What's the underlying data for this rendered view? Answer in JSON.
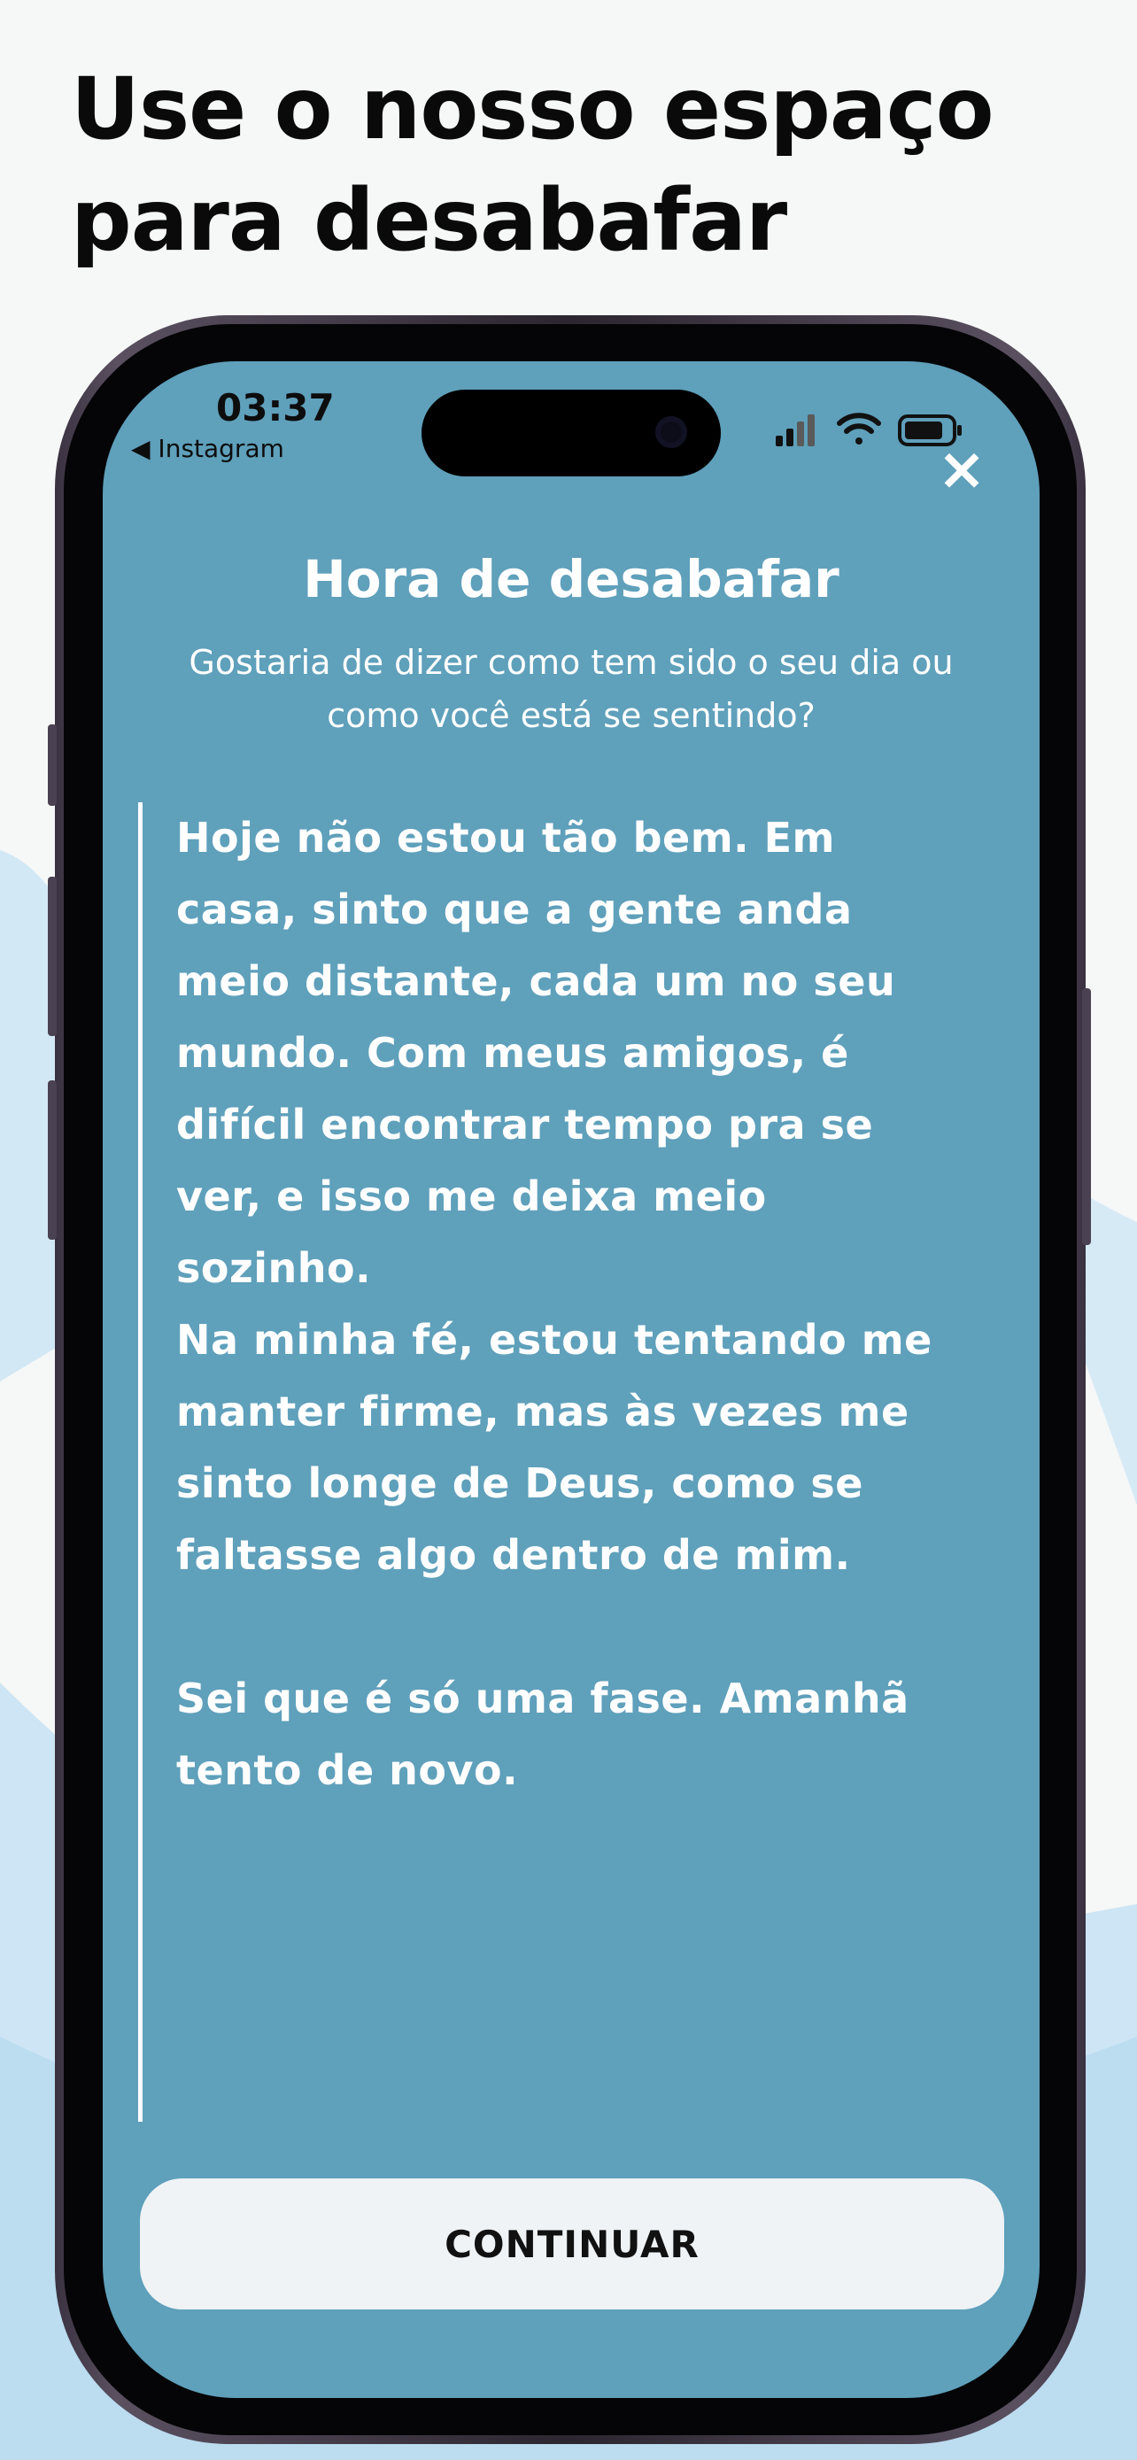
{
  "headline": {
    "line1": "Use o nosso espaço",
    "line2": "para desabafar"
  },
  "status_bar": {
    "time": "03:37",
    "back_label": "◀ Instagram",
    "icons": [
      "cellular-signal-icon",
      "wifi-icon",
      "battery-icon"
    ]
  },
  "modal": {
    "close_icon": "×",
    "title": "Hora de desabafar",
    "subtitle": "Gostaria de dizer como tem sido o seu dia ou como você está se sentindo?",
    "entry_text": "Hoje não estou tão bem. Em casa, sinto que a gente anda meio distante, cada um no seu mundo. Com meus amigos, é difícil encontrar tempo pra se ver, e isso me deixa meio sozinho.\nNa minha fé, estou tentando me manter firme, mas às vezes me sinto longe de Deus, como se faltasse algo dentro de mim.\n\nSei que é só uma fase. Amanhã tento de novo.",
    "continue_label": "CONTINUAR"
  },
  "colors": {
    "screen_bg": "#5fa0bb",
    "button_bg": "#eff3f6",
    "page_bg": "#f6f8f7",
    "wave_blue": "#cfe6f4"
  }
}
